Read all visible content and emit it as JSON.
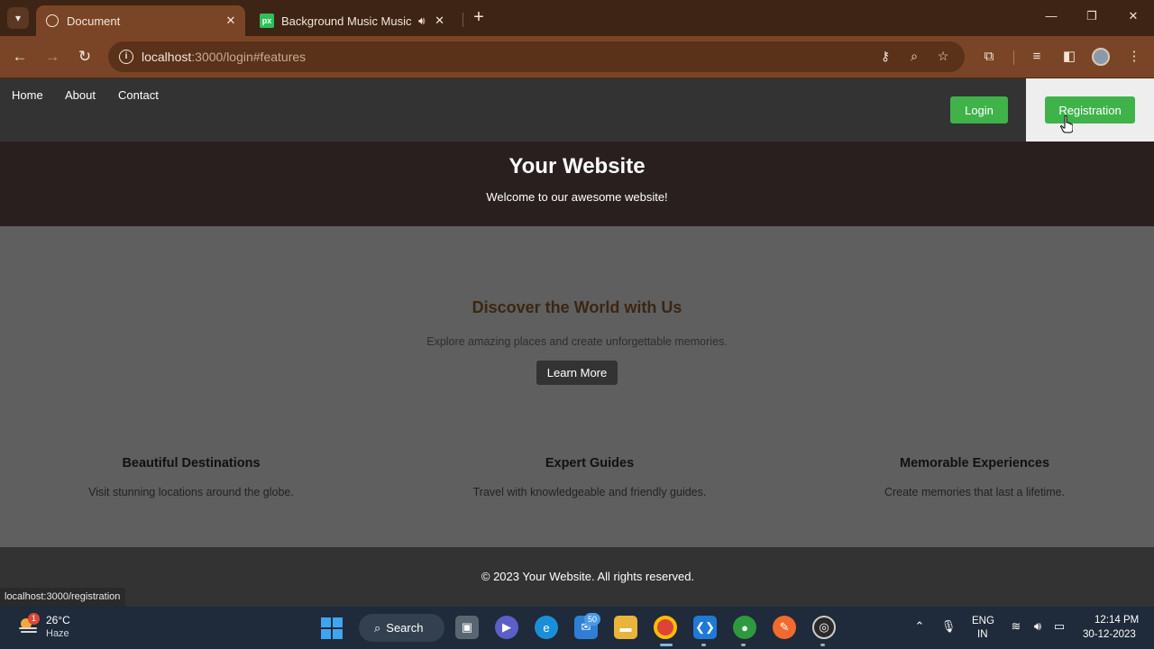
{
  "browser": {
    "tabs": [
      {
        "title": "Document",
        "active": true
      },
      {
        "title": "Background Music Music | Royalty-free",
        "active": false
      }
    ],
    "url_host": "localhost",
    "url_path": ":3000/login#features",
    "new_tab": "+",
    "window_controls": {
      "minimize": "—",
      "restore": "❐",
      "close": "✕"
    }
  },
  "site": {
    "nav": [
      {
        "label": "Home"
      },
      {
        "label": "About"
      },
      {
        "label": "Contact"
      }
    ],
    "login_label": "Login",
    "registration_label": "Registration",
    "hero_title": "Your Website",
    "hero_subtitle": "Welcome to our awesome website!",
    "discover_title": "Discover the World with Us",
    "discover_text": "Explore amazing places and create unforgettable memories.",
    "learn_more_label": "Learn More",
    "features": [
      {
        "title": "Beautiful Destinations",
        "text": "Visit stunning locations around the globe."
      },
      {
        "title": "Expert Guides",
        "text": "Travel with knowledgeable and friendly guides."
      },
      {
        "title": "Memorable Experiences",
        "text": "Create memories that last a lifetime."
      }
    ],
    "footer_text": "© 2023 Your Website. All rights reserved.",
    "status_url": "localhost:3000/registration"
  },
  "taskbar": {
    "weather_temp": "26°C",
    "weather_desc": "Haze",
    "weather_badge": "1",
    "search_label": "Search",
    "mail_badge": "50",
    "lang_top": "ENG",
    "lang_bottom": "IN",
    "time": "12:14 PM",
    "date": "30-12-2023"
  },
  "colors": {
    "accent_green": "#3fb34a",
    "nav_dark": "#333333",
    "hero_dark": "#2a1f1f",
    "browser_brown": "#7a4526"
  }
}
